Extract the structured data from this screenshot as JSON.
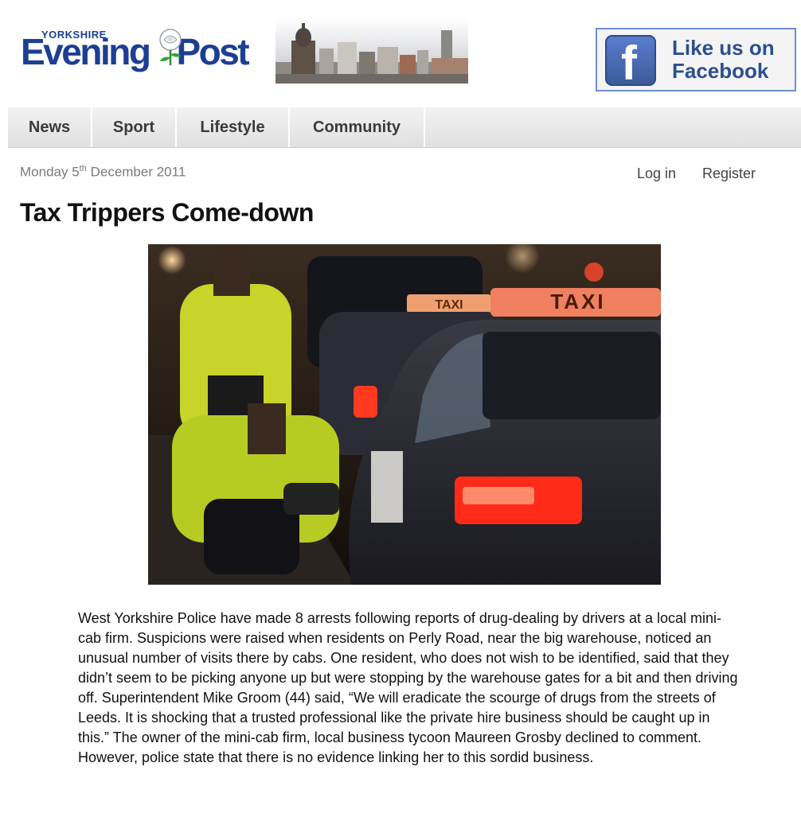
{
  "header": {
    "logo_small": "YORKSHIRE",
    "logo_main_1": "Evening",
    "logo_main_2": "Post",
    "facebook_line1": "Like us on",
    "facebook_line2": "Facebook",
    "facebook_letter": "f"
  },
  "nav": {
    "items": [
      {
        "label": "News"
      },
      {
        "label": "Sport"
      },
      {
        "label": "Lifestyle"
      },
      {
        "label": "Community"
      }
    ]
  },
  "meta": {
    "date_prefix": "Monday 5",
    "date_sup": "th",
    "date_suffix": " December 2011",
    "login_label": "Log in",
    "register_label": "Register"
  },
  "article": {
    "headline": "Tax Trippers Come-down",
    "photo_sign_1": "TAXI",
    "photo_sign_2": "TAXI",
    "body": "West Yorkshire Police have made 8 arrests following reports of drug-dealing by drivers at a local mini-cab firm.  Suspicions were raised when residents on Perly Road, near the big warehouse, noticed an unusual number of visits there by cabs.  One resident, who does not wish to be identified, said that they didn’t seem to be picking anyone up but were stopping by the warehouse gates for a bit and then driving off.  Superintendent Mike Groom (44) said, “We will eradicate the scourge of drugs from the streets of Leeds.  It is shocking that a trusted professional like the private hire business should be caught up in this.” The owner of the mini-cab firm, local business tycoon Maureen Grosby declined to comment.  However, police state that there is no evidence linking her to this sordid business."
  },
  "colors": {
    "brand_blue": "#1c3f94",
    "facebook_blue": "#3b5998",
    "nav_text": "#3a3a3a",
    "date_text": "#7a7a7a"
  }
}
